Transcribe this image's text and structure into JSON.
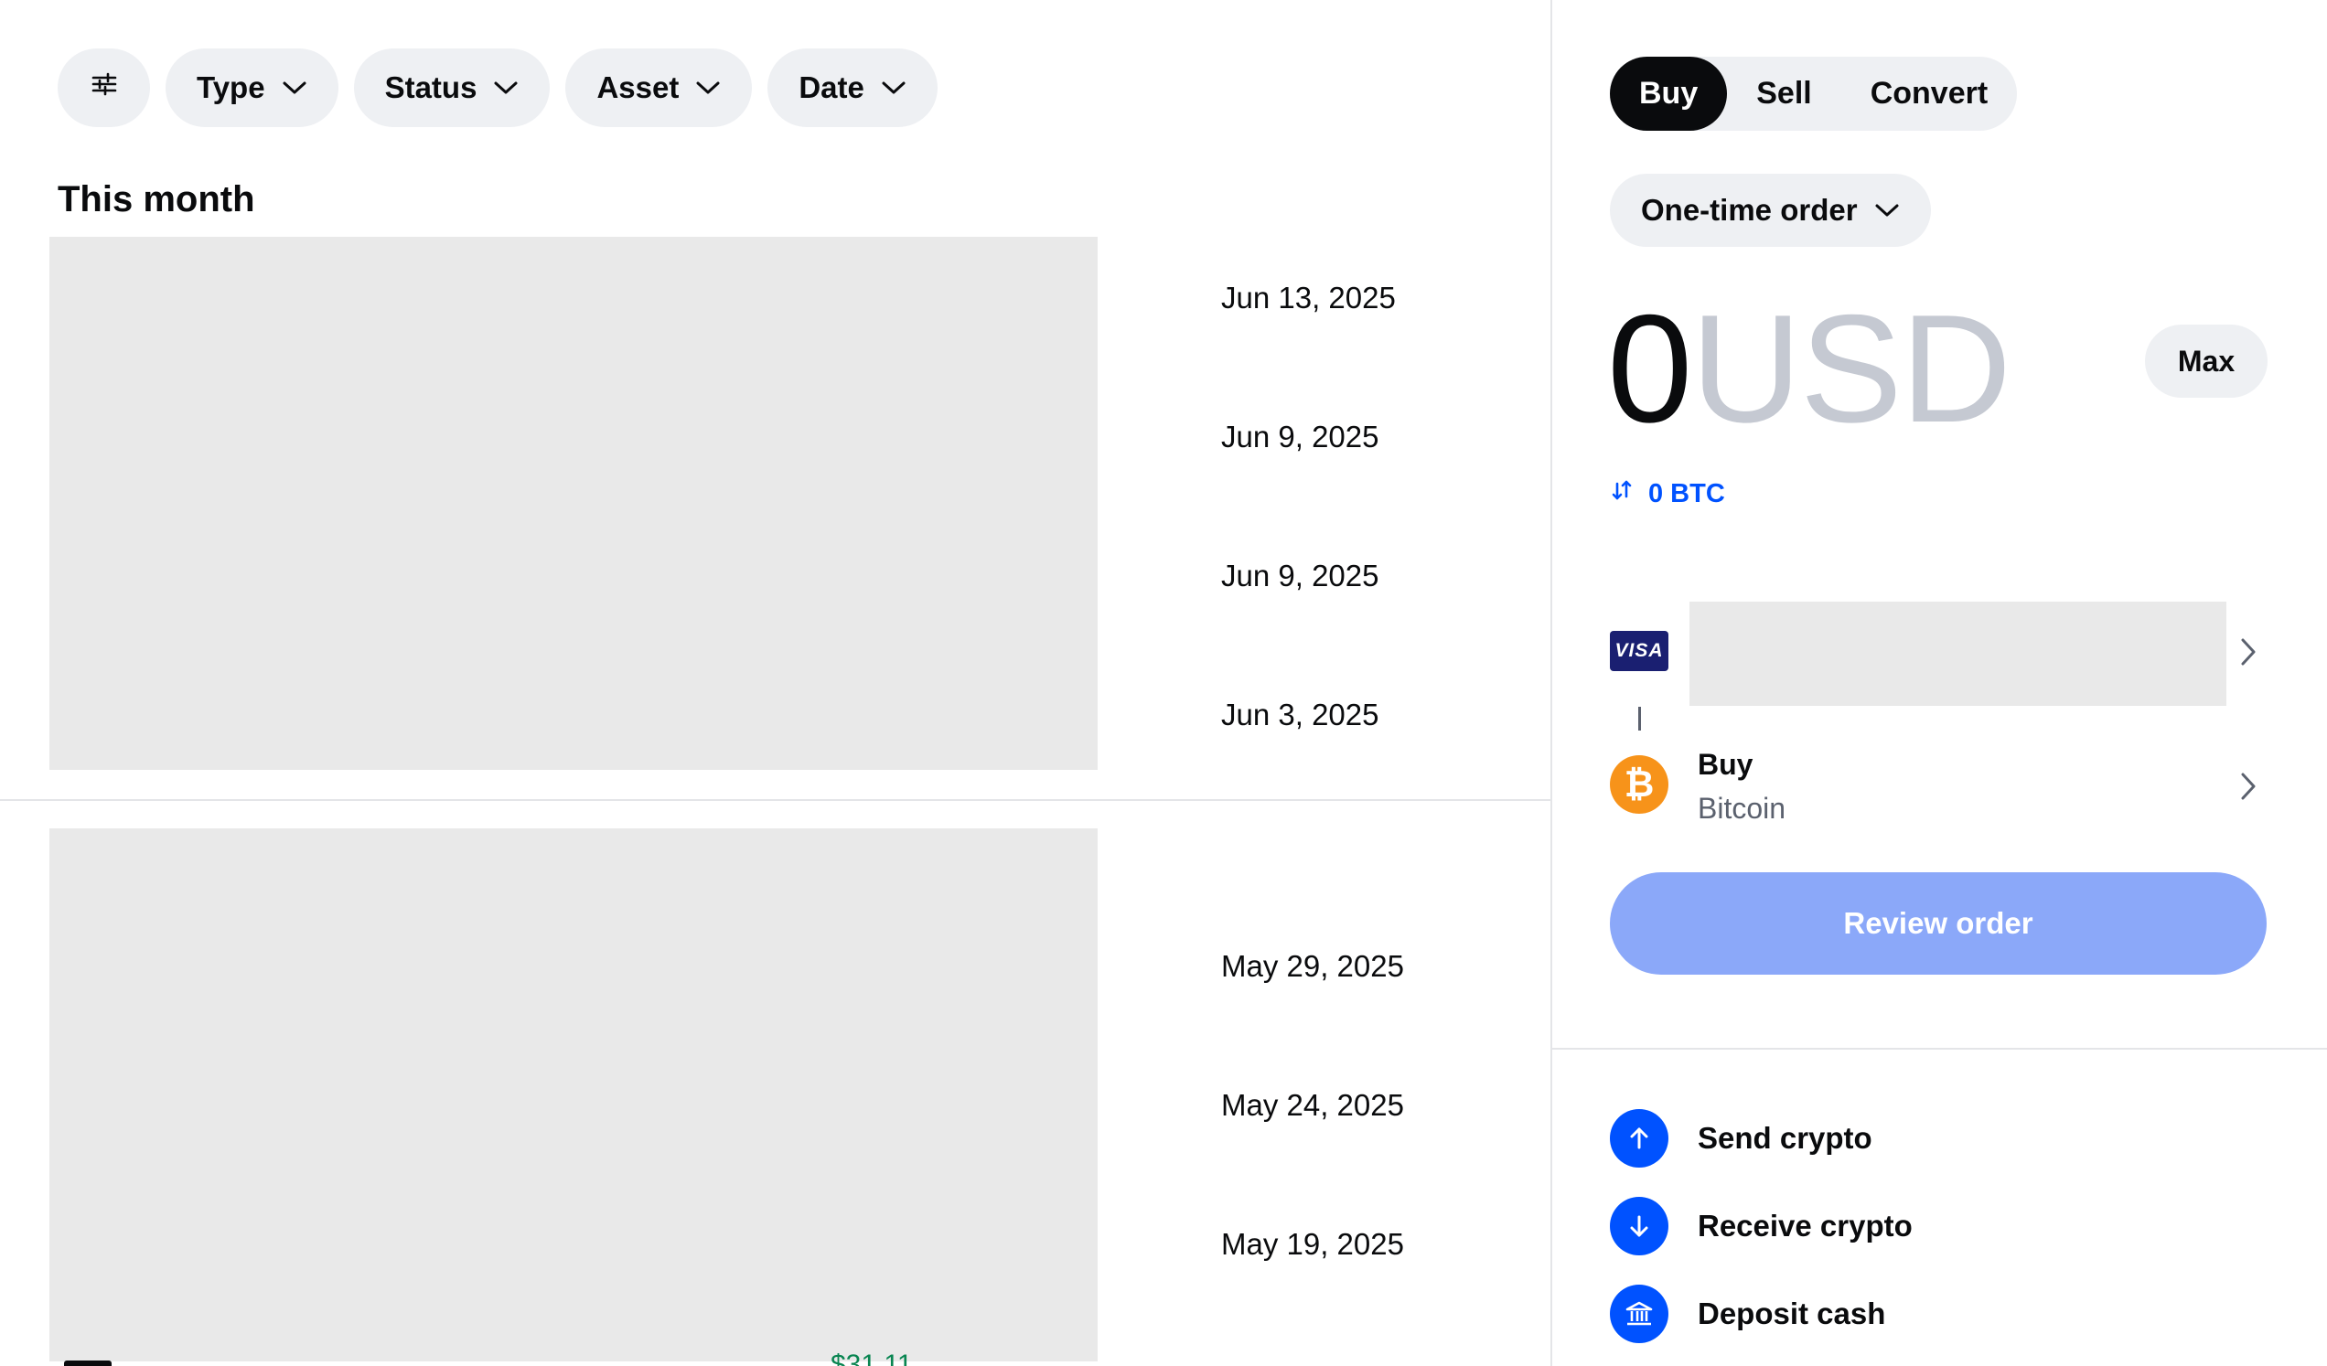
{
  "filters": {
    "items": [
      {
        "label": "Type"
      },
      {
        "label": "Status"
      },
      {
        "label": "Asset"
      },
      {
        "label": "Date"
      }
    ]
  },
  "transactions": {
    "section_title": "This month",
    "dates_group1": [
      "Jun 13, 2025",
      "Jun 9, 2025",
      "Jun 9, 2025",
      "Jun 3, 2025"
    ],
    "dates_group2": [
      "May 29, 2025",
      "May 24, 2025",
      "May 19, 2025"
    ],
    "cut_amount": "$31.11"
  },
  "trade": {
    "tabs": [
      {
        "label": "Buy",
        "active": true
      },
      {
        "label": "Sell",
        "active": false
      },
      {
        "label": "Convert",
        "active": false
      }
    ],
    "order_type": "One-time order",
    "amount_value": "0",
    "amount_currency": "USD",
    "max_label": "Max",
    "conversion": "0 BTC",
    "payment_brand": "VISA",
    "asset_action": "Buy",
    "asset_name": "Bitcoin",
    "asset_symbol": "₿",
    "review_label": "Review order"
  },
  "actions": [
    {
      "label": "Send crypto",
      "icon": "arrow-up-icon"
    },
    {
      "label": "Receive crypto",
      "icon": "arrow-down-icon"
    },
    {
      "label": "Deposit cash",
      "icon": "bank-icon"
    }
  ],
  "colors": {
    "accent": "#0052ff",
    "review_disabled": "#8ba8f9",
    "chip_bg": "#eef0f3",
    "bitcoin": "#f7931a",
    "muted_text": "#c5c9d2"
  }
}
